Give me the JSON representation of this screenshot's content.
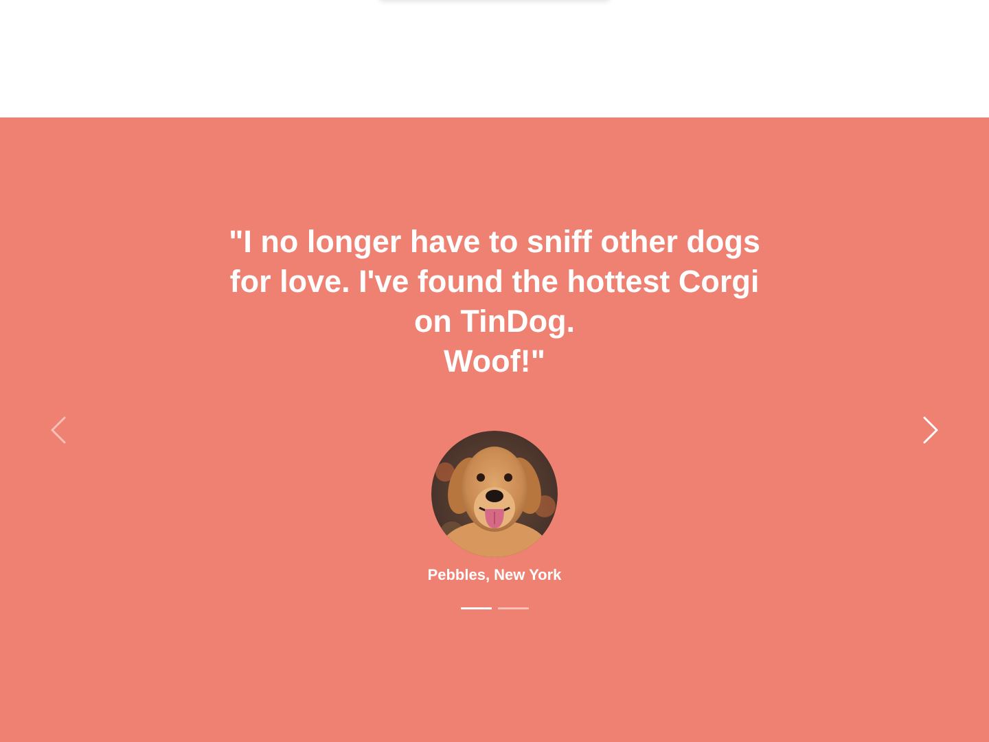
{
  "testimonial": {
    "quote_lines": [
      "\"I no longer have to sniff other dogs",
      "for love. I've found the hottest Corgi",
      "on TinDog.",
      "Woof!\""
    ],
    "author": "Pebbles, New York",
    "avatar_icon": "golden-retriever-photo",
    "prev_icon": "chevron-left-icon",
    "next_icon": "chevron-right-icon",
    "slide_count": 2,
    "active_slide": 1
  },
  "colors": {
    "section_background": "#ef8172",
    "text": "#ffffff"
  }
}
